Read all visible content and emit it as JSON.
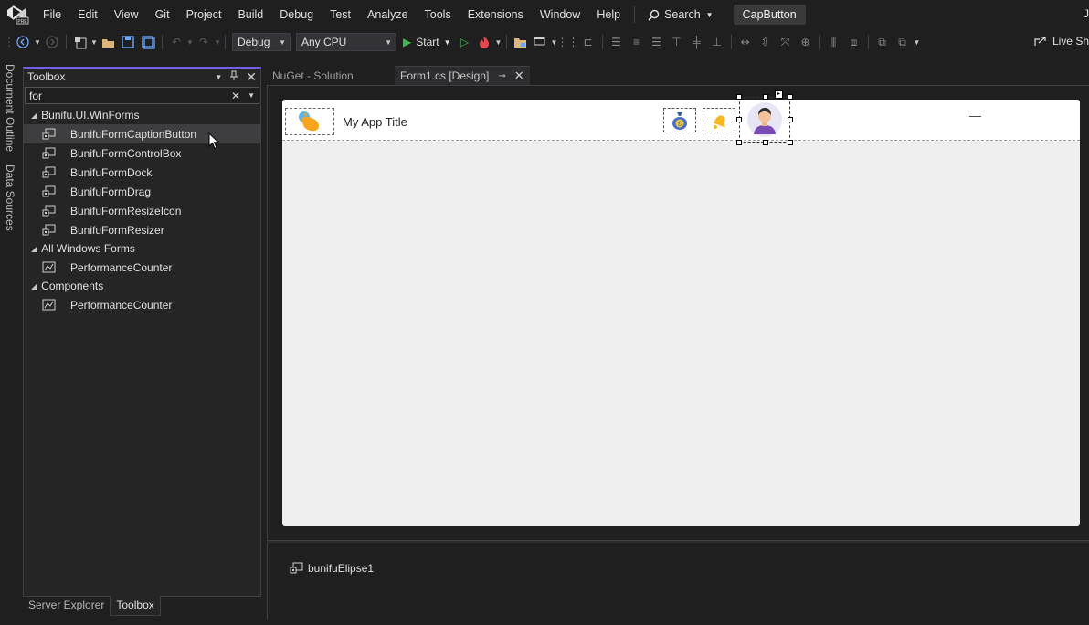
{
  "menubar": {
    "items": [
      "File",
      "Edit",
      "View",
      "Git",
      "Project",
      "Build",
      "Debug",
      "Test",
      "Analyze",
      "Tools",
      "Extensions",
      "Window",
      "Help"
    ],
    "search_label": "Search",
    "solution_badge": "CapButton",
    "user_initial": "J"
  },
  "toolbar": {
    "config": "Debug",
    "platform": "Any CPU",
    "start_label": "Start",
    "live_share": "Live Sh"
  },
  "left_tabs": [
    "Document Outline",
    "Data Sources"
  ],
  "toolbox": {
    "title": "Toolbox",
    "search_value": "for",
    "groups": [
      {
        "name": "Bunifu.UI.WinForms",
        "items": [
          "BunifuFormCaptionButton",
          "BunifuFormControlBox",
          "BunifuFormDock",
          "BunifuFormDrag",
          "BunifuFormResizeIcon",
          "BunifuFormResizer"
        ]
      },
      {
        "name": "All Windows Forms",
        "items": [
          "PerformanceCounter"
        ]
      },
      {
        "name": "Components",
        "items": [
          "PerformanceCounter"
        ]
      }
    ],
    "selected_item": "BunifuFormCaptionButton"
  },
  "bottom_tabs": [
    "Server Explorer",
    "Toolbox"
  ],
  "doc_tabs": [
    {
      "label": "NuGet - Solution",
      "active": false
    },
    {
      "label": "Form1.cs [Design]",
      "active": true
    }
  ],
  "form": {
    "title": "My App Title",
    "minimize_glyph": "—"
  },
  "tray": {
    "component": "bunifuElipse1"
  },
  "colors": {
    "accent": "#7160e8",
    "background": "#1f1f1f",
    "panel": "#252526",
    "selection": "#3e3e40"
  }
}
